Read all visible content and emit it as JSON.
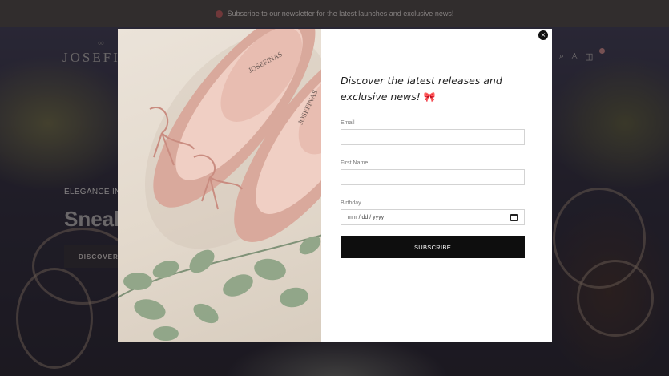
{
  "announcement": {
    "text": "Subscribe to our newsletter for the latest launches and exclusive news!"
  },
  "site": {
    "logo": "JOSEFI",
    "hero_tagline": "ELEGANCE IN",
    "hero_headline": "Sneak",
    "hero_button": "DISCOVER"
  },
  "header_icons": [
    "search-icon",
    "account-icon",
    "cart-icon"
  ],
  "modal": {
    "title": "Discover the latest releases and exclusive news!",
    "title_emoji": "🎀",
    "close_glyph": "×",
    "image_brand_text": "JOSEFINAS",
    "fields": {
      "email_label": "Email",
      "first_name_label": "First Name",
      "birthday_label": "Birthday",
      "birthday_placeholder": "mm / dd / yyyy"
    },
    "subscribe_label": "SUBSCRIBE"
  },
  "colors": {
    "announcement_bg": "#4b4542",
    "button_bg": "#0e0e0e",
    "shoe_pink": "#e2b3a8"
  }
}
